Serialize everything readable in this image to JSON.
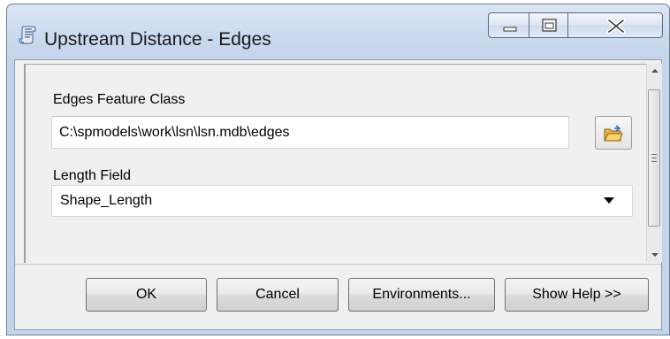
{
  "window": {
    "title": "Upstream Distance - Edges",
    "app_icon": "geoprocessing-script-icon",
    "caption_buttons": [
      "minimize-icon",
      "maximize-icon",
      "close-icon"
    ]
  },
  "form": {
    "edges_label": "Edges Feature Class",
    "edges_value": "C:\\spmodels\\work\\lsn\\lsn.mdb\\edges",
    "browse_icon": "open-folder-icon",
    "length_label": "Length Field",
    "length_value": "Shape_Length"
  },
  "buttons": {
    "ok": "OK",
    "cancel": "Cancel",
    "environments": "Environments...",
    "show_help": "Show Help >>"
  },
  "scrollbar": {
    "position": 0
  }
}
